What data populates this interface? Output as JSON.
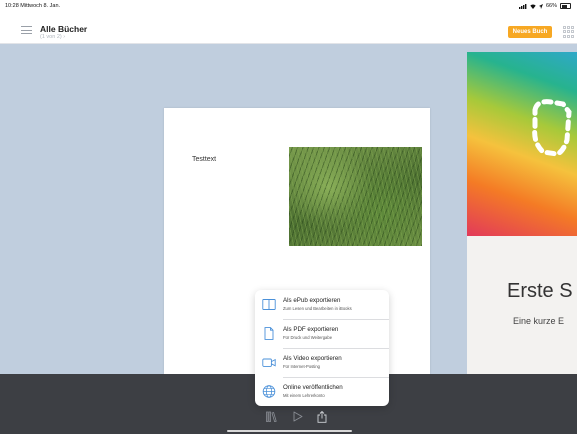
{
  "status_bar": {
    "time": "10:28 Mittwoch 8. Jan.",
    "battery": "66%"
  },
  "header": {
    "title": "Alle Bücher",
    "subtitle": "(1 von 2) ›",
    "new_book_label": "Neues Buch"
  },
  "page": {
    "text": "Testtext"
  },
  "cover": {
    "title": "Erste S",
    "subtitle": "Eine kurze E"
  },
  "export_menu": {
    "items": [
      {
        "label": "Als ePub exportieren",
        "description": "Zum Lesen und Bearbeiten in iBooks",
        "icon": "book-icon"
      },
      {
        "label": "Als PDF exportieren",
        "description": "Für Druck und Weitergabe",
        "icon": "document-icon"
      },
      {
        "label": "Als Video exportieren",
        "description": "Für Internet-Posting",
        "icon": "video-icon"
      },
      {
        "label": "Online veröffentlichen",
        "description": "Mit einem Lehrerkonto",
        "icon": "globe-icon"
      }
    ]
  },
  "toolbar": {
    "icons": [
      "library-icon",
      "play-icon",
      "share-icon"
    ]
  },
  "colors": {
    "accent": "#f7a823",
    "canvas": "#c0cede",
    "toolbar": "#3d3f44",
    "icon_blue": "#4a90d9"
  }
}
